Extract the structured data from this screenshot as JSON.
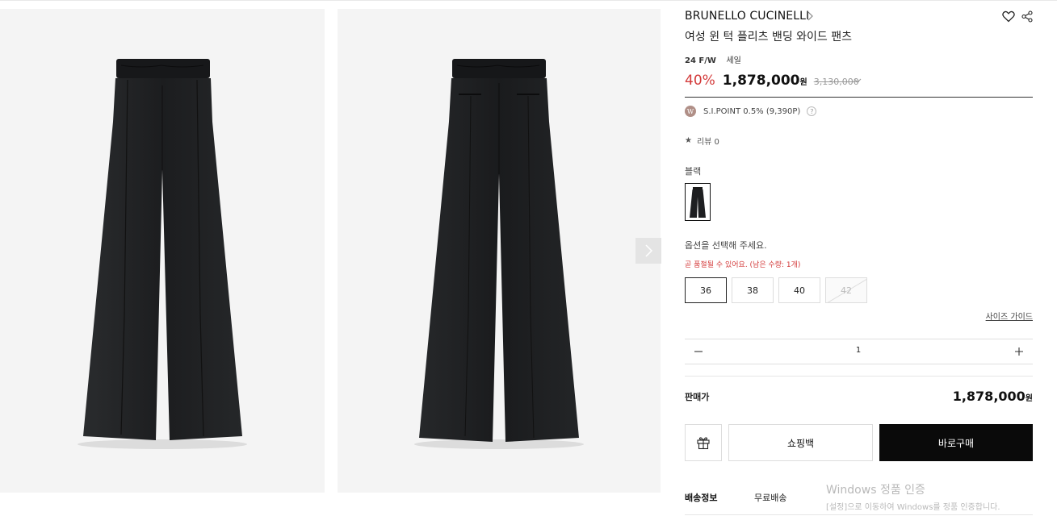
{
  "gallery": {
    "images": [
      {
        "alt": "black wide pants front view",
        "icon": "pants-front-photo"
      },
      {
        "alt": "black wide pants back view",
        "icon": "pants-back-photo"
      }
    ],
    "next_icon": "chevron-right-icon"
  },
  "product": {
    "brand": "BRUNELLO CUCINELLI",
    "name": "여성 윈 턱 플리츠 밴딩 와이드 팬츠",
    "season": "24 F/W",
    "sale_tag": "세일",
    "discount": "40%",
    "price": "1,878,000",
    "currency": "원",
    "original_price": "3,130,000",
    "points_badge": "W",
    "points": "S.I.POINT 0.5% (9,390P)",
    "help": "?",
    "review": "리뷰 0",
    "color_label": "블랙"
  },
  "options": {
    "prompt": "옵션을 선택해 주세요.",
    "stock_warning": "곧 품절될 수 있어요. (남은 수량: 1개)",
    "sizes": [
      {
        "label": "36",
        "state": "selected"
      },
      {
        "label": "38",
        "state": "available"
      },
      {
        "label": "40",
        "state": "available"
      },
      {
        "label": "42",
        "state": "sold-out"
      }
    ],
    "size_guide": "사이즈 가이드"
  },
  "quantity": {
    "value": "1"
  },
  "summary": {
    "label": "판매가",
    "price": "1,878,000",
    "currency": "원"
  },
  "actions": {
    "bag": "쇼핑백",
    "buy": "바로구매"
  },
  "shipping": {
    "label": "배송정보",
    "value": "무료배송"
  },
  "watermark": {
    "title": "Windows 정품 인증",
    "subtitle": "[설정]으로 이동하여 Windows를 정품 인증합니다."
  },
  "colors": {
    "accent_red": "#d33a3a",
    "primary_black": "#0a0a0a",
    "border": "#dddddd",
    "image_bg": "#f4f4f4"
  }
}
